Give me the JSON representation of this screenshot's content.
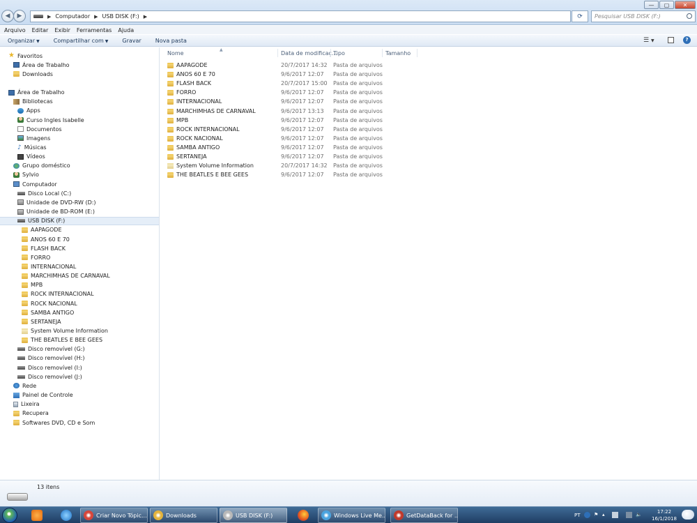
{
  "window": {
    "breadcrumb": [
      "Computador",
      "USB DISK (F:)"
    ],
    "search_placeholder": "Pesquisar USB DISK (F:)",
    "controls": {
      "minimize": "—",
      "maximize": "▢",
      "close": "✕"
    }
  },
  "menu": [
    "Arquivo",
    "Editar",
    "Exibir",
    "Ferramentas",
    "Ajuda"
  ],
  "commands": {
    "organize": "Organizar",
    "share": "Compartilhar com",
    "burn": "Gravar",
    "new_folder": "Nova pasta"
  },
  "columns": {
    "name": "Nome",
    "date": "Data de modificaç...",
    "type": "Tipo",
    "size": "Tamanho"
  },
  "files": [
    {
      "name": "AAPAGODE",
      "date": "20/7/2017 14:32",
      "type": "Pasta de arquivos",
      "icon": "folder-icon"
    },
    {
      "name": "ANOS 60 E 70",
      "date": "9/6/2017 12:07",
      "type": "Pasta de arquivos",
      "icon": "folder-icon"
    },
    {
      "name": "FLASH BACK",
      "date": "20/7/2017 15:00",
      "type": "Pasta de arquivos",
      "icon": "folder-icon"
    },
    {
      "name": "FORRO",
      "date": "9/6/2017 12:07",
      "type": "Pasta de arquivos",
      "icon": "folder-icon"
    },
    {
      "name": "INTERNACIONAL",
      "date": "9/6/2017 12:07",
      "type": "Pasta de arquivos",
      "icon": "folder-icon"
    },
    {
      "name": "MARCHIMHAS DE CARNAVAL",
      "date": "9/6/2017 13:13",
      "type": "Pasta de arquivos",
      "icon": "folder-icon"
    },
    {
      "name": "MPB",
      "date": "9/6/2017 12:07",
      "type": "Pasta de arquivos",
      "icon": "folder-icon"
    },
    {
      "name": "ROCK INTERNACIONAL",
      "date": "9/6/2017 12:07",
      "type": "Pasta de arquivos",
      "icon": "folder-icon"
    },
    {
      "name": "ROCK NACIONAL",
      "date": "9/6/2017 12:07",
      "type": "Pasta de arquivos",
      "icon": "folder-icon"
    },
    {
      "name": "SAMBA ANTIGO",
      "date": "9/6/2017 12:07",
      "type": "Pasta de arquivos",
      "icon": "folder-icon"
    },
    {
      "name": "SERTANEJA",
      "date": "9/6/2017 12:07",
      "type": "Pasta de arquivos",
      "icon": "folder-icon"
    },
    {
      "name": "System Volume Information",
      "date": "20/7/2017 14:32",
      "type": "Pasta de arquivos",
      "icon": "system-folder-icon"
    },
    {
      "name": "THE BEATLES E BEE GEES",
      "date": "9/6/2017 12:07",
      "type": "Pasta de arquivos",
      "icon": "folder-icon"
    }
  ],
  "nav": [
    {
      "label": "Favoritos",
      "icon": "star",
      "level": 0
    },
    {
      "label": "Área de Trabalho",
      "icon": "desktop",
      "level": 1
    },
    {
      "label": "Downloads",
      "icon": "folder",
      "level": 1
    },
    {
      "label": "",
      "icon": "",
      "level": -1
    },
    {
      "label": "Área de Trabalho",
      "icon": "desktop",
      "level": 0
    },
    {
      "label": "Bibliotecas",
      "icon": "library",
      "level": 1
    },
    {
      "label": "Apps",
      "icon": "apps",
      "level": 2
    },
    {
      "label": "Curso Ingles Isabelle",
      "icon": "user",
      "level": 2
    },
    {
      "label": "Documentos",
      "icon": "doc",
      "level": 2
    },
    {
      "label": "Imagens",
      "icon": "img",
      "level": 2
    },
    {
      "label": "Músicas",
      "icon": "music",
      "level": 2
    },
    {
      "label": "Vídeos",
      "icon": "video",
      "level": 2
    },
    {
      "label": "Grupo doméstico",
      "icon": "homegroup",
      "level": 1
    },
    {
      "label": "Sylvio",
      "icon": "user",
      "level": 1
    },
    {
      "label": "Computador",
      "icon": "computer",
      "level": 1
    },
    {
      "label": "Disco Local (C:)",
      "icon": "drive",
      "level": 2
    },
    {
      "label": "Unidade de DVD-RW (D:)",
      "icon": "dvd",
      "level": 2
    },
    {
      "label": "Unidade de BD-ROM (E:)",
      "icon": "dvd",
      "level": 2
    },
    {
      "label": "USB DISK (F:)",
      "icon": "drive",
      "level": 2,
      "selected": true
    },
    {
      "label": "AAPAGODE",
      "icon": "folder",
      "level": 3
    },
    {
      "label": "ANOS 60 E 70",
      "icon": "folder",
      "level": 3
    },
    {
      "label": "FLASH BACK",
      "icon": "folder",
      "level": 3
    },
    {
      "label": "FORRO",
      "icon": "folder",
      "level": 3
    },
    {
      "label": "INTERNACIONAL",
      "icon": "folder",
      "level": 3
    },
    {
      "label": "MARCHIMHAS DE CARNAVAL",
      "icon": "folder",
      "level": 3
    },
    {
      "label": "MPB",
      "icon": "folder",
      "level": 3
    },
    {
      "label": "ROCK INTERNACIONAL",
      "icon": "folder",
      "level": 3
    },
    {
      "label": "ROCK NACIONAL",
      "icon": "folder",
      "level": 3
    },
    {
      "label": "SAMBA ANTIGO",
      "icon": "folder",
      "level": 3
    },
    {
      "label": "SERTANEJA",
      "icon": "folder",
      "level": 3
    },
    {
      "label": "System Volume Information",
      "icon": "sysfolder",
      "level": 3
    },
    {
      "label": "THE BEATLES E BEE GEES",
      "icon": "folder",
      "level": 3
    },
    {
      "label": "Disco removível (G:)",
      "icon": "drive",
      "level": 2
    },
    {
      "label": "Disco removível (H:)",
      "icon": "drive",
      "level": 2
    },
    {
      "label": "Disco removível (I:)",
      "icon": "drive",
      "level": 2
    },
    {
      "label": "Disco removível (J:)",
      "icon": "drive",
      "level": 2
    },
    {
      "label": "Rede",
      "icon": "network",
      "level": 1
    },
    {
      "label": "Painel de Controle",
      "icon": "control",
      "level": 1
    },
    {
      "label": "Lixeira",
      "icon": "trash",
      "level": 1
    },
    {
      "label": "Recupera",
      "icon": "folder",
      "level": 1
    },
    {
      "label": "Softwares DVD, CD e Som",
      "icon": "folder",
      "level": 1
    }
  ],
  "details": {
    "item_count": "13 itens"
  },
  "taskbar": {
    "tasks": [
      {
        "label": "Criar Novo Tópic...",
        "icon": "chrome-icon",
        "color": "#d6453a"
      },
      {
        "label": "Downloads",
        "icon": "folder-icon",
        "color": "#e3b33d"
      },
      {
        "label": "USB DISK (F:)",
        "icon": "usb-drive-icon",
        "color": "#b8b8b8",
        "active": true
      },
      {
        "label": "Windows Live Me...",
        "icon": "windows-live-icon",
        "color": "#4aa3df"
      },
      {
        "label": "GetDataBack for ...",
        "icon": "getdataback-icon",
        "color": "#c0392b"
      }
    ],
    "tray": {
      "language": "PT",
      "time": "17:22",
      "date": "16/1/2018"
    }
  }
}
